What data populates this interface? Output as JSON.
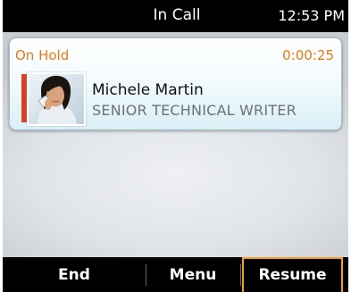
{
  "status_bar": {
    "title": "In Call",
    "time": "12:53 PM"
  },
  "call": {
    "status": "On Hold",
    "duration": "0:00:25",
    "contact": {
      "name": "Michele Martin",
      "title": "SENIOR TECHNICAL WRITER"
    }
  },
  "soft_keys": [
    {
      "label": "End"
    },
    {
      "label": "Menu"
    },
    {
      "label": "Resume",
      "selected": true
    }
  ],
  "colors": {
    "accent": "#e07b1a",
    "hold_indicator": "#d8401f",
    "selection_outline": "#f0a020"
  }
}
